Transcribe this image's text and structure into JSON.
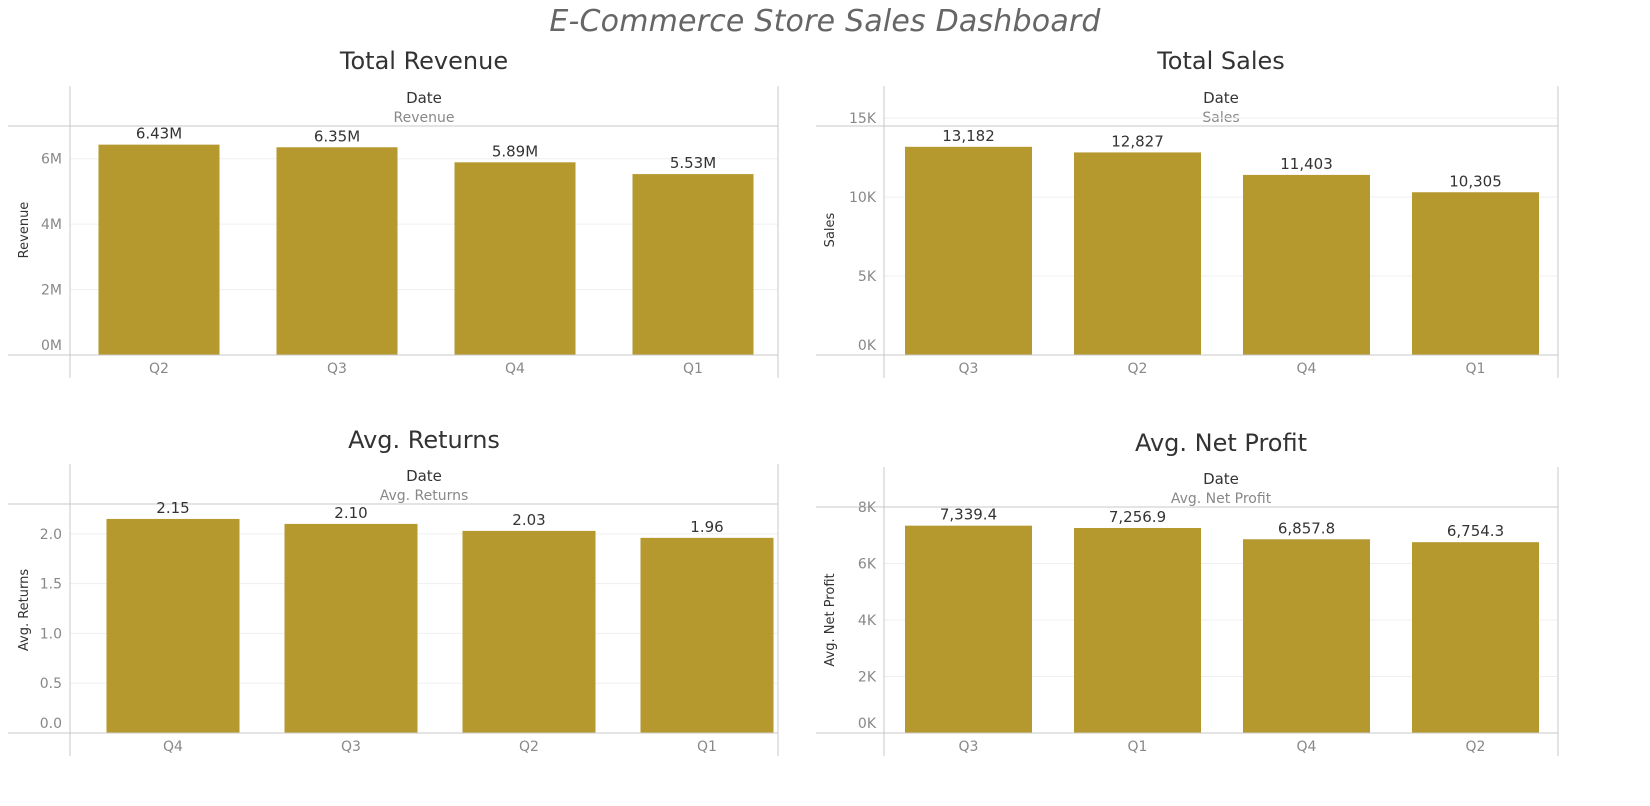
{
  "dashboard": {
    "title": "E-Commerce Store Sales Dashboard"
  },
  "colors": {
    "bar": "#b5992e",
    "axis": "#c8c8c8",
    "grid": "#efefef"
  },
  "chart_data": [
    {
      "type": "bar",
      "title": "Total Revenue",
      "header": "Date",
      "subheader": "Revenue",
      "ylabel": "Revenue",
      "categories": [
        "Q2",
        "Q3",
        "Q4",
        "Q1"
      ],
      "values": [
        6430000,
        6350000,
        5890000,
        5530000
      ],
      "value_labels": [
        "6.43M",
        "6.35M",
        "5.89M",
        "5.53M"
      ],
      "ylim": [
        0,
        7000000
      ],
      "ticks": [
        0,
        2000000,
        4000000,
        6000000
      ],
      "tick_labels": [
        "0M",
        "2M",
        "4M",
        "6M"
      ],
      "grid": true
    },
    {
      "type": "bar",
      "title": "Total Sales",
      "header": "Date",
      "subheader": "Sales",
      "ylabel": "Sales",
      "categories": [
        "Q3",
        "Q2",
        "Q4",
        "Q1"
      ],
      "values": [
        13182,
        12827,
        11403,
        10305
      ],
      "value_labels": [
        "13,182",
        "12,827",
        "11,403",
        "10,305"
      ],
      "ylim": [
        0,
        14500
      ],
      "ticks": [
        0,
        5000,
        10000,
        15000
      ],
      "tick_labels": [
        "0K",
        "5K",
        "10K",
        "15K"
      ],
      "grid": true
    },
    {
      "type": "bar",
      "title": "Avg. Returns",
      "header": "Date",
      "subheader": "Avg. Returns",
      "ylabel": "Avg. Returns",
      "categories": [
        "Q4",
        "Q3",
        "Q2",
        "Q1"
      ],
      "values": [
        2.15,
        2.1,
        2.03,
        1.96
      ],
      "value_labels": [
        "2.15",
        "2.10",
        "2.03",
        "1.96"
      ],
      "ylim": [
        0,
        2.3
      ],
      "ticks": [
        0,
        0.5,
        1.0,
        1.5,
        2.0
      ],
      "tick_labels": [
        "0.0",
        "0.5",
        "1.0",
        "1.5",
        "2.0"
      ],
      "grid": true
    },
    {
      "type": "bar",
      "title": "Avg. Net Profit",
      "header": "Date",
      "subheader": "Avg. Net Profit",
      "ylabel": "Avg. Net Profit",
      "categories": [
        "Q3",
        "Q1",
        "Q4",
        "Q2"
      ],
      "values": [
        7339.4,
        7256.9,
        6857.8,
        6754.3
      ],
      "value_labels": [
        "7,339.4",
        "7,256.9",
        "6,857.8",
        "6,754.3"
      ],
      "ylim": [
        0,
        8000
      ],
      "ticks": [
        0,
        2000,
        4000,
        6000,
        8000
      ],
      "tick_labels": [
        "0K",
        "2K",
        "4K",
        "6K",
        "8K"
      ],
      "grid": true
    }
  ]
}
